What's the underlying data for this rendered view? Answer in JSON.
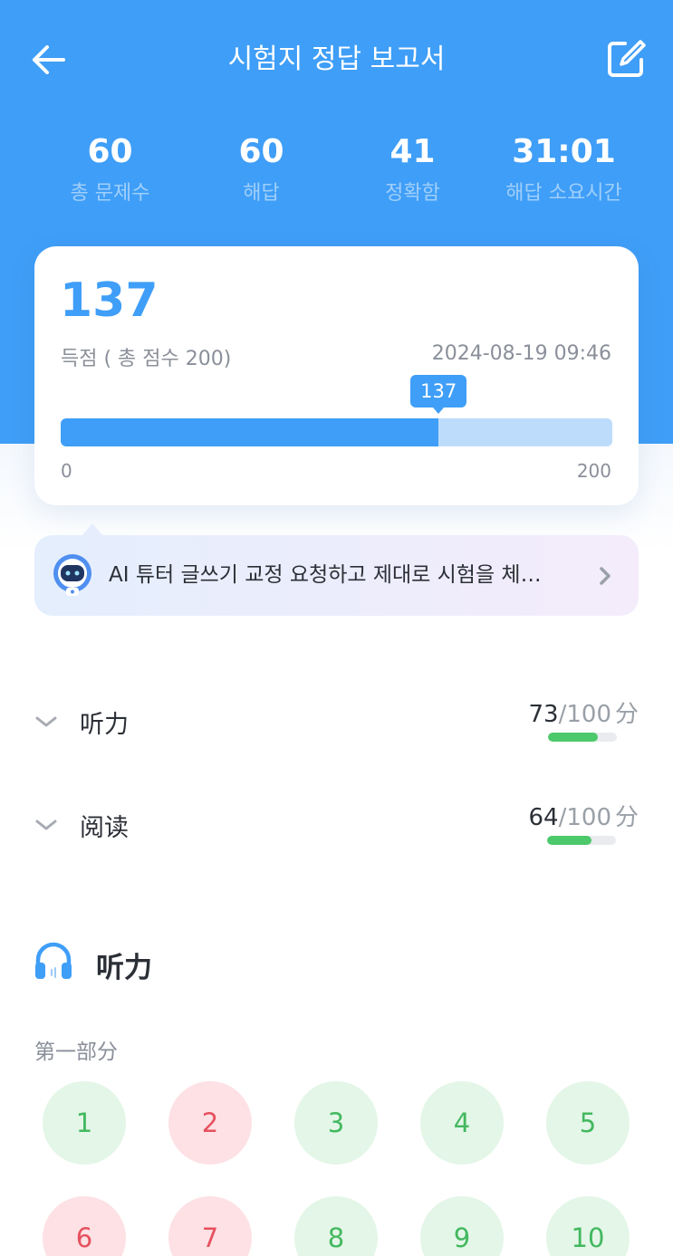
{
  "header": {
    "title": "시험지 정답 보고서",
    "stats": [
      {
        "value": "60",
        "label": "총 문제수"
      },
      {
        "value": "60",
        "label": "해답"
      },
      {
        "value": "41",
        "label": "정확함"
      },
      {
        "value": "31:01",
        "label": "해답 소요시간"
      }
    ]
  },
  "score_card": {
    "score": "137",
    "caption": "득점 ( 총 점수 200)",
    "date": "2024-08-19 09:46",
    "bar_tip": "137",
    "axis_min": "0",
    "axis_max": "200",
    "progress_value": 137,
    "progress_max": 200
  },
  "ai_banner": {
    "text": "AI 튜터 글쓰기 교정 요청하고 제대로 시험을 체…"
  },
  "sections": [
    {
      "label": "听力",
      "score": "73",
      "total": "/100",
      "unit": "分",
      "fraction": 0.73
    },
    {
      "label": "阅读",
      "score": "64",
      "total": "/100",
      "unit": "分",
      "fraction": 0.64
    }
  ],
  "listening": {
    "title": "听力",
    "part_label": "第一部分",
    "questions": [
      {
        "num": "1",
        "status": "correct"
      },
      {
        "num": "2",
        "status": "wrong"
      },
      {
        "num": "3",
        "status": "correct"
      },
      {
        "num": "4",
        "status": "correct"
      },
      {
        "num": "5",
        "status": "correct"
      },
      {
        "num": "6",
        "status": "wrong"
      },
      {
        "num": "7",
        "status": "wrong"
      },
      {
        "num": "8",
        "status": "correct"
      },
      {
        "num": "9",
        "status": "correct"
      },
      {
        "num": "10",
        "status": "correct"
      }
    ]
  },
  "colors": {
    "primary": "#3f9ef7",
    "correct": "#43b85f",
    "wrong": "#e6505e"
  },
  "icons": {
    "back": "arrow-left-icon",
    "edit": "edit-icon",
    "ai": "robot-avatar-icon",
    "banner_arrow": "chevron-right-icon",
    "row": "chevron-down-icon",
    "listening": "headphones-icon"
  }
}
